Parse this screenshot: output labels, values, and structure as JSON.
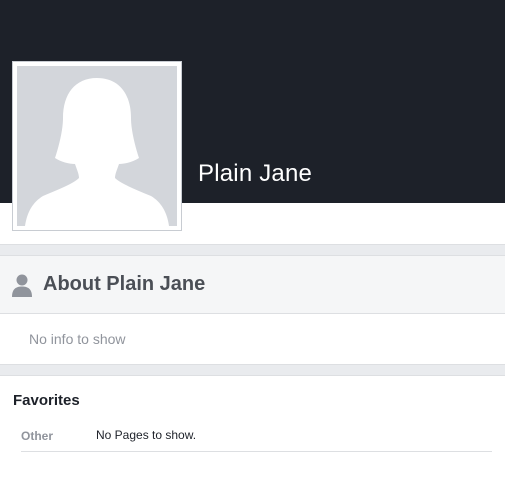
{
  "profile": {
    "name": "Plain Jane"
  },
  "about": {
    "title": "About Plain Jane",
    "icon": "person-icon",
    "empty_text": "No info to show"
  },
  "favorites": {
    "title": "Favorites",
    "rows": [
      {
        "label": "Other",
        "value": "No Pages to show."
      }
    ]
  },
  "colors": {
    "cover": "#1d2129",
    "section_bg": "#f5f6f7",
    "muted_text": "#90949c"
  }
}
